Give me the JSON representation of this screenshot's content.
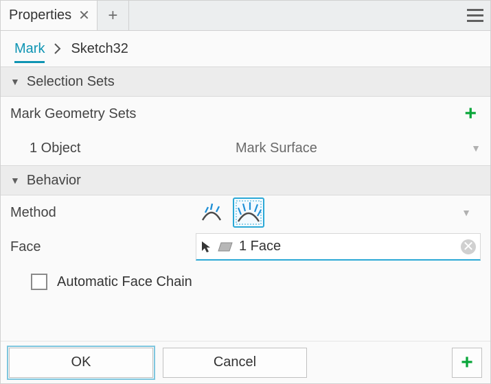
{
  "tab": {
    "label": "Properties"
  },
  "breadcrumb": {
    "active": "Mark",
    "next": "Sketch32"
  },
  "sections": {
    "selection_sets": {
      "title": "Selection Sets",
      "subtitle": "Mark Geometry Sets",
      "object_count": "1 Object",
      "object_type": "Mark Surface"
    },
    "behavior": {
      "title": "Behavior",
      "method_label": "Method",
      "face_label": "Face",
      "face_value": "1 Face",
      "auto_chain_label": "Automatic Face Chain",
      "auto_chain_checked": false
    }
  },
  "buttons": {
    "ok": "OK",
    "cancel": "Cancel"
  }
}
